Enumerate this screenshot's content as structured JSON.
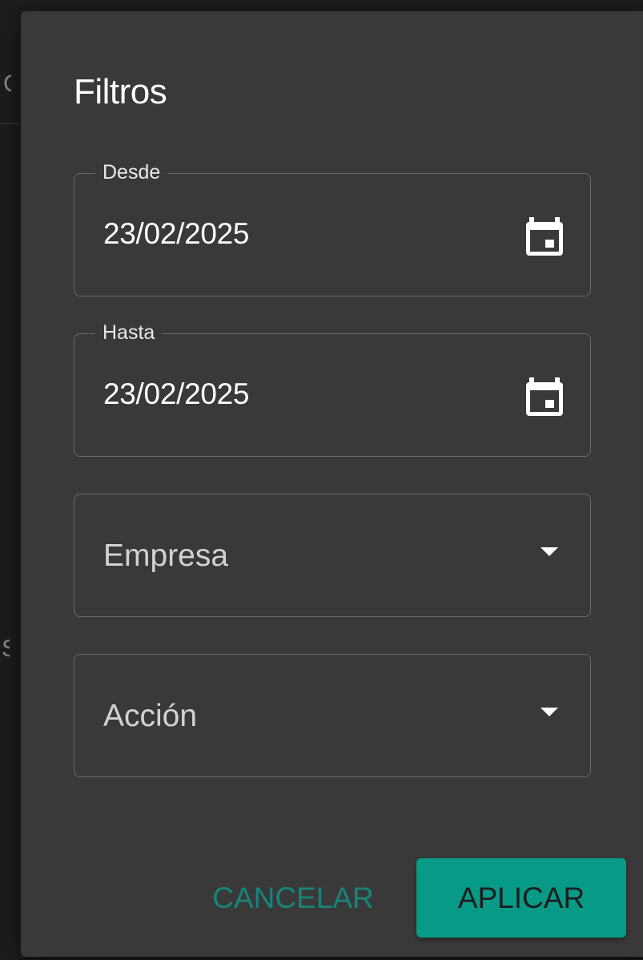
{
  "background": {
    "fragment_top": "C",
    "fragment_bottom": "S"
  },
  "dialog": {
    "title": "Filtros",
    "fields": {
      "desde": {
        "label": "Desde",
        "value": "23/02/2025",
        "icon": "calendar-icon"
      },
      "hasta": {
        "label": "Hasta",
        "value": "23/02/2025",
        "icon": "calendar-icon"
      },
      "empresa": {
        "placeholder": "Empresa",
        "icon": "dropdown-arrow-icon"
      },
      "accion": {
        "placeholder": "Acción",
        "icon": "dropdown-arrow-icon"
      }
    },
    "actions": {
      "cancel_label": "CANCELAR",
      "apply_label": "APLICAR"
    }
  },
  "colors": {
    "accent": "#079a87",
    "cancel_text": "#17847a",
    "dialog_bg": "#393939",
    "border": "#6b6b6b"
  }
}
